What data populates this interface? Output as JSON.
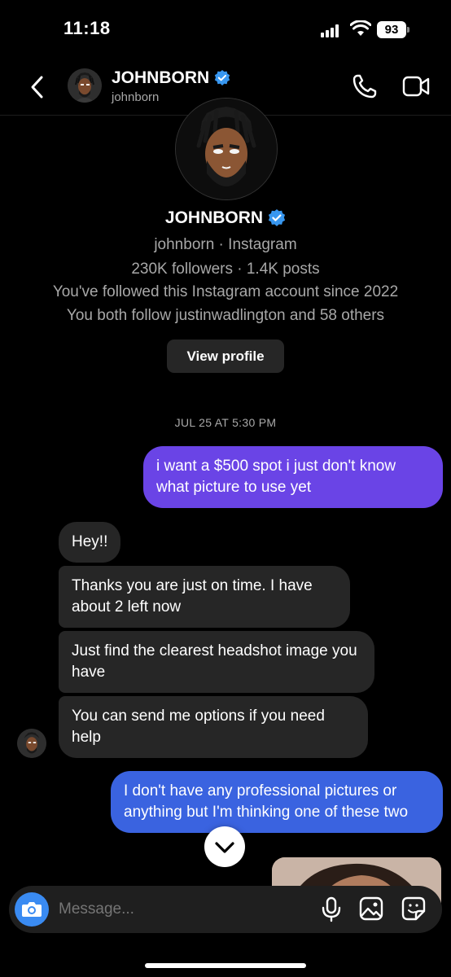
{
  "status_bar": {
    "time": "11:18",
    "battery": "93"
  },
  "header": {
    "name": "JOHNBORN",
    "handle": "johnborn"
  },
  "profile": {
    "name": "JOHNBORN",
    "subtitle": "johnborn · Instagram",
    "stats": "230K followers · 1.4K posts",
    "followed_since": "You've followed this Instagram account since 2022",
    "mutuals": "You both follow justinwadlington and 58 others",
    "view_profile_label": "View profile"
  },
  "conversation": {
    "date": "JUL 25 AT 5:30 PM",
    "messages": [
      {
        "from": "me",
        "text": "i want a $500 spot i just don't know what picture to use yet"
      },
      {
        "from": "them",
        "text": "Hey!!"
      },
      {
        "from": "them",
        "text": "Thanks you are just on time. I have about 2 left now"
      },
      {
        "from": "them",
        "text": "Just find the clearest headshot image you have"
      },
      {
        "from": "them",
        "text": "You can send me options if you need help"
      },
      {
        "from": "me",
        "text": "I don't have any professional pictures or anything but I'm thinking one of these two"
      }
    ]
  },
  "composer": {
    "placeholder": "Message..."
  },
  "colors": {
    "outgoing_purple": "#6a44e6",
    "outgoing_blue": "#3a63e0",
    "incoming": "#262626",
    "verified": "#3897f0",
    "camera": "#3a8bf2"
  }
}
